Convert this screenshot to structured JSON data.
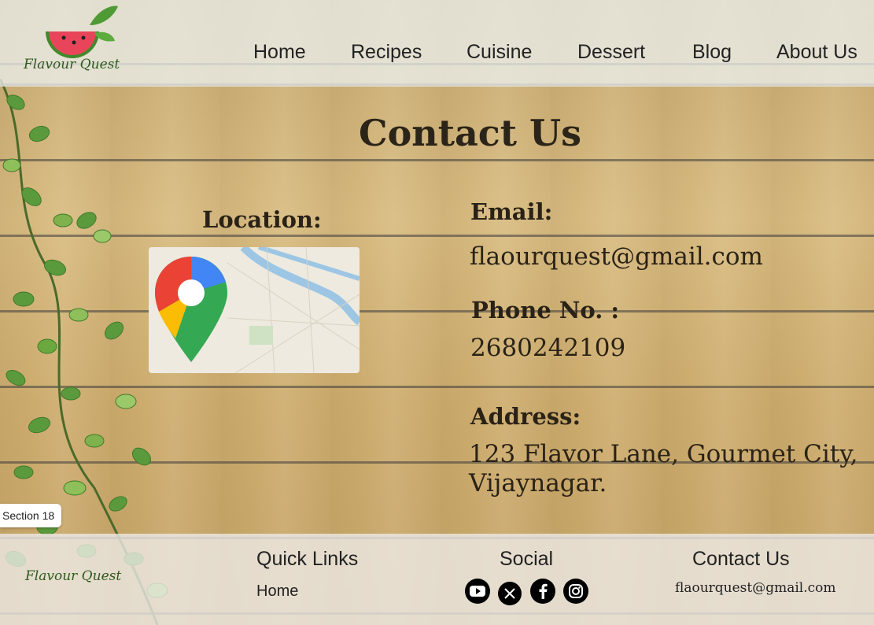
{
  "header": {
    "logo_text": "Flavour Quest",
    "nav": [
      {
        "label": "Home"
      },
      {
        "label": "Recipes"
      },
      {
        "label": "Cuisine"
      },
      {
        "label": "Dessert"
      },
      {
        "label": "Blog"
      },
      {
        "label": "About Us"
      }
    ]
  },
  "main": {
    "title": "Contact Us",
    "location_label": "Location:",
    "email_label": "Email:",
    "email": "flaourquest@gmail.com",
    "phone_label": "Phone No. :",
    "phone": "2680242109",
    "address_label": "Address:",
    "address_line1": "123 Flavor Lane, Gourmet City,",
    "address_line2": "Vijaynagar."
  },
  "badge": "Section 18",
  "footer": {
    "logo_text": "Flavour Quest",
    "quick_links_title": "Quick Links",
    "quick_links": [
      "Home"
    ],
    "social_title": "Social",
    "social_icons": [
      "youtube-icon",
      "x-icon",
      "facebook-icon",
      "instagram-icon"
    ],
    "contact_title": "Contact Us",
    "contact_email": "flaourquest@gmail.com"
  },
  "colors": {
    "leaf_green": "#5b9a3c",
    "logo_red": "#e8455a",
    "text_dark": "#2a2216"
  }
}
